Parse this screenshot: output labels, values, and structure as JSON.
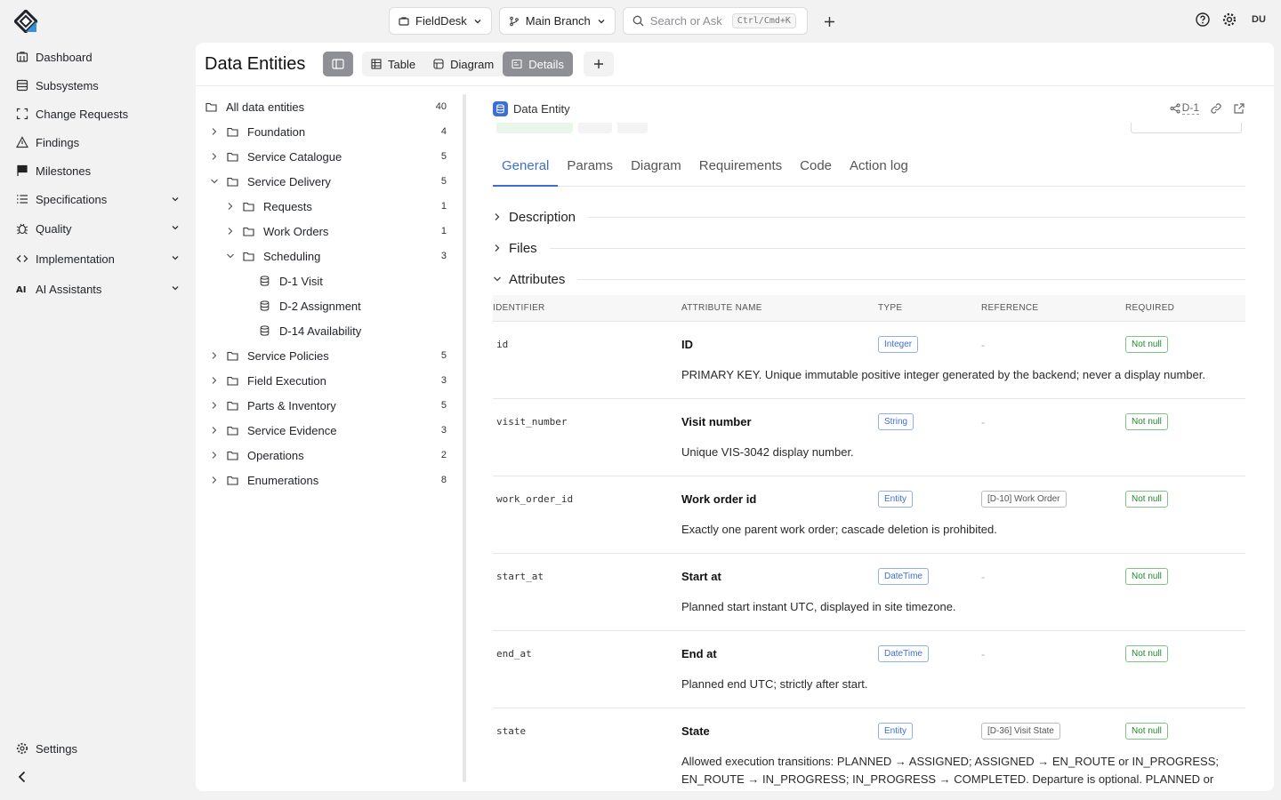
{
  "topbar": {
    "project": "FieldDesk",
    "branch": "Main Branch",
    "search_placeholder": "Search or Ask",
    "search_shortcut": "Ctrl/Cmd+K",
    "avatar": "DU"
  },
  "sidebar": {
    "items": [
      {
        "label": "Dashboard",
        "icon": "dashboard-icon"
      },
      {
        "label": "Subsystems",
        "icon": "subsystems-icon"
      },
      {
        "label": "Change Requests",
        "icon": "change-requests-icon"
      },
      {
        "label": "Findings",
        "icon": "warning-icon"
      },
      {
        "label": "Milestones",
        "icon": "flag-icon"
      },
      {
        "label": "Specifications",
        "icon": "list-icon"
      },
      {
        "label": "Quality",
        "icon": "bug-icon"
      },
      {
        "label": "Implementation",
        "icon": "code-icon"
      },
      {
        "label": "AI Assistants",
        "icon": "ai-icon"
      }
    ],
    "settings": "Settings"
  },
  "page": {
    "title": "Data Entities",
    "views": [
      "Table",
      "Diagram",
      "Details"
    ],
    "active_view": "Details"
  },
  "tree": {
    "root": {
      "label": "All data entities",
      "count": "40"
    },
    "items": [
      {
        "label": "Foundation",
        "count": "4"
      },
      {
        "label": "Service Catalogue",
        "count": "5"
      },
      {
        "label": "Service Delivery",
        "count": "5"
      },
      {
        "label": "Requests",
        "count": "1"
      },
      {
        "label": "Work Orders",
        "count": "1"
      },
      {
        "label": "Scheduling",
        "count": "3"
      },
      {
        "label": "D-1 Visit",
        "count": ""
      },
      {
        "label": "D-2 Assignment",
        "count": ""
      },
      {
        "label": "D-14 Availability",
        "count": ""
      },
      {
        "label": "Service Policies",
        "count": "5"
      },
      {
        "label": "Field Execution",
        "count": "3"
      },
      {
        "label": "Parts & Inventory",
        "count": "5"
      },
      {
        "label": "Service Evidence",
        "count": "3"
      },
      {
        "label": "Operations",
        "count": "2"
      },
      {
        "label": "Enumerations",
        "count": "8"
      }
    ]
  },
  "detail": {
    "kind": "Data Entity",
    "ref": "D-1",
    "tabs": [
      "General",
      "Params",
      "Diagram",
      "Requirements",
      "Code",
      "Action log"
    ],
    "sections": [
      "Description",
      "Files",
      "Attributes"
    ],
    "table_headers": [
      "IDENTIFIER",
      "ATTRIBUTE NAME",
      "TYPE",
      "REFERENCE",
      "REQUIRED"
    ],
    "attributes": [
      {
        "id": "id",
        "name": "ID",
        "type": "Integer",
        "reference": "-",
        "required": "Not null",
        "desc": "PRIMARY KEY. Unique immutable positive integer generated by the backend; never a display number."
      },
      {
        "id": "visit_number",
        "name": "Visit number",
        "type": "String",
        "reference": "-",
        "required": "Not null",
        "desc": "Unique VIS-3042 display number."
      },
      {
        "id": "work_order_id",
        "name": "Work order id",
        "type": "Entity",
        "reference": "[D-10] Work Order",
        "required": "Not null",
        "desc": "Exactly one parent work order; cascade deletion is prohibited."
      },
      {
        "id": "start_at",
        "name": "Start at",
        "type": "DateTime",
        "reference": "-",
        "required": "Not null",
        "desc": "Planned start instant UTC, displayed in site timezone."
      },
      {
        "id": "end_at",
        "name": "End at",
        "type": "DateTime",
        "reference": "-",
        "required": "Not null",
        "desc": "Planned end UTC; strictly after start."
      },
      {
        "id": "state",
        "name": "State",
        "type": "Entity",
        "reference": "[D-36] Visit State",
        "required": "Not null",
        "desc": "Allowed execution transitions: PLANNED → ASSIGNED; ASSIGNED → EN_ROUTE or IN_PROGRESS; EN_ROUTE → IN_PROGRESS; IN_PROGRESS → COMPLETED. Departure is optional. PLANNED or ASSIGNED may be"
      }
    ]
  }
}
